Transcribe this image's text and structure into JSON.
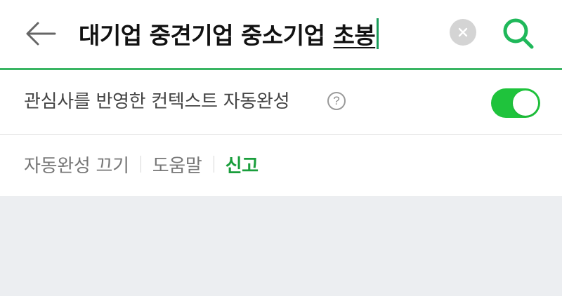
{
  "search": {
    "query": "대기업 중견기업 중소기업",
    "composing": "초봉"
  },
  "context_autocomplete": {
    "label": "관심사를 반영한 컨텍스트 자동완성",
    "help": "?",
    "enabled": true,
    "toggle_color": "#1fc33c"
  },
  "links": {
    "autocomplete_off": "자동완성 끄기",
    "help": "도움말",
    "report": "신고"
  },
  "colors": {
    "accent": "#39b563",
    "report": "#1a9e3c",
    "background": "#eceef1"
  },
  "icons": {
    "back": "arrow-left-icon",
    "clear": "clear-x-icon",
    "search": "green-search-icon"
  }
}
